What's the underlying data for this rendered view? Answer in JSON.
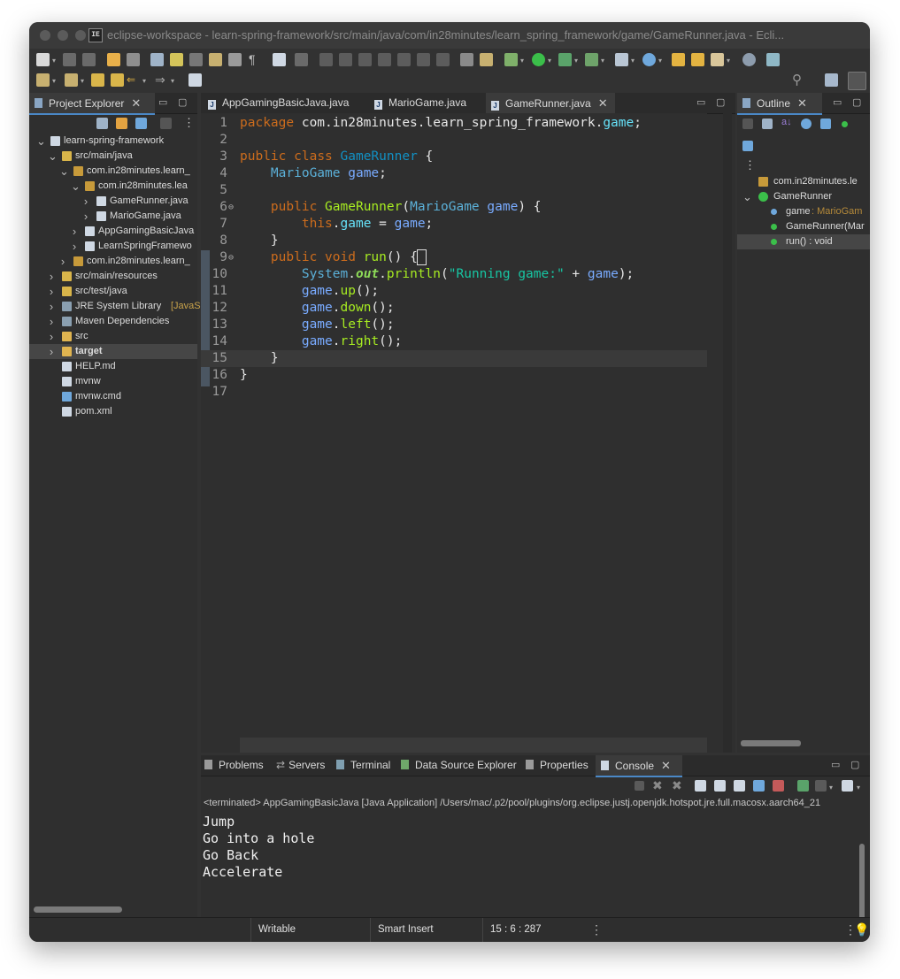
{
  "window": {
    "title": "eclipse-workspace - learn-spring-framework/src/main/java/com/in28minutes/learn_spring_framework/game/GameRunner.java - Ecli..."
  },
  "project_explorer": {
    "tab_label": "Project Explorer",
    "tree": [
      {
        "label": "learn-spring-framework",
        "chevron": "v",
        "icon": "project-icon"
      },
      {
        "label": "src/main/java",
        "chevron": "v",
        "icon": "source-folder-icon"
      },
      {
        "label": "com.in28minutes.learn_",
        "chevron": "v",
        "icon": "package-icon"
      },
      {
        "label": "com.in28minutes.lea",
        "chevron": "v",
        "icon": "package-icon"
      },
      {
        "label": "GameRunner.java",
        "chevron": ">",
        "icon": "java-file-icon"
      },
      {
        "label": "MarioGame.java",
        "chevron": ">",
        "icon": "java-file-icon"
      },
      {
        "label": "AppGamingBasicJava",
        "chevron": ">",
        "icon": "java-file-icon"
      },
      {
        "label": "LearnSpringFramewo",
        "chevron": ">",
        "icon": "java-file-icon"
      },
      {
        "label": "com.in28minutes.learn_",
        "chevron": ">",
        "icon": "package-icon"
      },
      {
        "label": "src/main/resources",
        "chevron": ">",
        "icon": "source-folder-icon"
      },
      {
        "label": "src/test/java",
        "chevron": ">",
        "icon": "source-folder-icon"
      },
      {
        "label": "JRE System Library",
        "suffix": "[JavaS",
        "chevron": ">",
        "icon": "library-icon"
      },
      {
        "label": "Maven Dependencies",
        "chevron": ">",
        "icon": "library-icon"
      },
      {
        "label": "src",
        "chevron": ">",
        "icon": "folder-icon"
      },
      {
        "label": "target",
        "chevron": ">",
        "icon": "folder-icon"
      },
      {
        "label": "HELP.md",
        "chevron": "",
        "icon": "markdown-file-icon"
      },
      {
        "label": "mvnw",
        "chevron": "",
        "icon": "file-icon"
      },
      {
        "label": "mvnw.cmd",
        "chevron": "",
        "icon": "cmd-file-icon"
      },
      {
        "label": "pom.xml",
        "chevron": "",
        "icon": "xml-file-icon"
      }
    ]
  },
  "editor": {
    "tabs": [
      {
        "label": "AppGamingBasicJava.java",
        "active": false
      },
      {
        "label": "MarioGame.java",
        "active": false
      },
      {
        "label": "GameRunner.java",
        "active": true
      }
    ],
    "line_numbers": [
      "1",
      "2",
      "3",
      "4",
      "5",
      "6",
      "7",
      "8",
      "9",
      "10",
      "11",
      "12",
      "13",
      "14",
      "15",
      "16",
      "17"
    ],
    "code_lines": [
      "package com.in28minutes.learn_spring_framework.game;",
      "",
      "public class GameRunner {",
      "    MarioGame game;",
      "",
      "    public GameRunner(MarioGame game) {",
      "        this.game = game;",
      "    }",
      "    public void run() {",
      "        System.out.println(\"Running game:\" + game);",
      "        game.up();",
      "        game.down();",
      "        game.left();",
      "        game.right();",
      "    }",
      "}",
      ""
    ]
  },
  "outline": {
    "tab_label": "Outline",
    "items": [
      {
        "label": "com.in28minutes.le",
        "icon": "package-icon"
      },
      {
        "label": "GameRunner",
        "icon": "class-icon"
      },
      {
        "label": "game",
        "suffix": " : MarioGam",
        "icon": "field-icon"
      },
      {
        "label": "GameRunner(Mar",
        "icon": "constructor-icon"
      },
      {
        "label": "run() : void",
        "icon": "method-icon"
      }
    ]
  },
  "bottom_tabs": [
    "Problems",
    "Servers",
    "Terminal",
    "Data Source Explorer",
    "Properties",
    "Console"
  ],
  "console": {
    "header": "<terminated> AppGamingBasicJava [Java Application] /Users/mac/.p2/pool/plugins/org.eclipse.justj.openjdk.hotspot.jre.full.macosx.aarch64_21",
    "output_lines": [
      "Jump",
      "Go into a hole",
      "Go Back",
      "Accelerate"
    ]
  },
  "status_bar": {
    "writable": "Writable",
    "insert_mode": "Smart Insert",
    "position": "15 : 6 : 287"
  },
  "colors": {
    "window_bg": "#323232",
    "keyword": "#cc6c1d",
    "type": "#5bb0d8",
    "field": "#66e1f8",
    "string": "#17c6a3",
    "method": "#a7ec21",
    "active_tab_accent": "#4a88c7"
  }
}
